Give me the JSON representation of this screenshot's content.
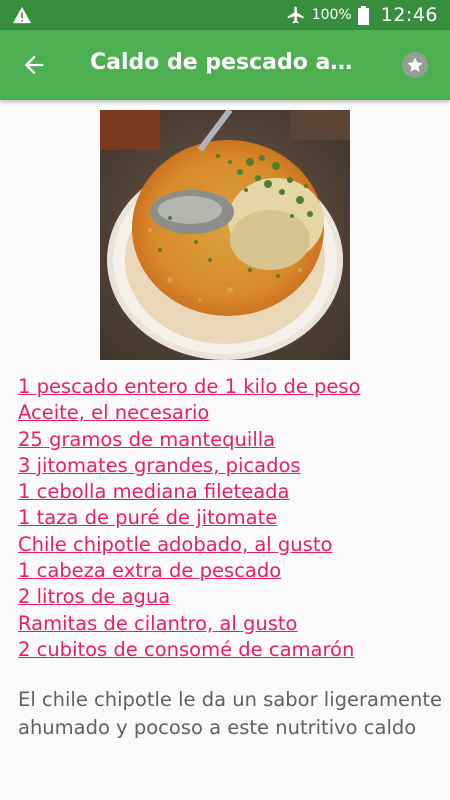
{
  "status_bar": {
    "battery": "100%",
    "time": "12:46"
  },
  "app_bar": {
    "title": "Caldo de pescado a la…"
  },
  "photo": {
    "alt": "Caldo de pescado"
  },
  "ingredients": [
    "1 pescado entero de 1 kilo de peso",
    "Aceite, el necesario",
    "25 gramos de mantequilla",
    "3 jitomates grandes, picados",
    "1 cebolla mediana fileteada",
    "1 taza de puré de jitomate",
    "Chile chipotle adobado, al gusto",
    "1 cabeza extra de pescado",
    "2 litros de agua",
    "Ramitas de cilantro, al gusto",
    "2 cubitos de consomé de camarón"
  ],
  "description": "El chile chipotle le da un sabor ligeramente ahumado y pocoso a este nutritivo caldo",
  "colors": {
    "status_bar": "#388e3c",
    "app_bar": "#4caf50",
    "link": "#e91e63",
    "text": "#616161"
  },
  "icons": [
    "warning-icon",
    "airplane-icon",
    "battery-icon",
    "back-arrow-icon",
    "favorite-star-icon"
  ]
}
